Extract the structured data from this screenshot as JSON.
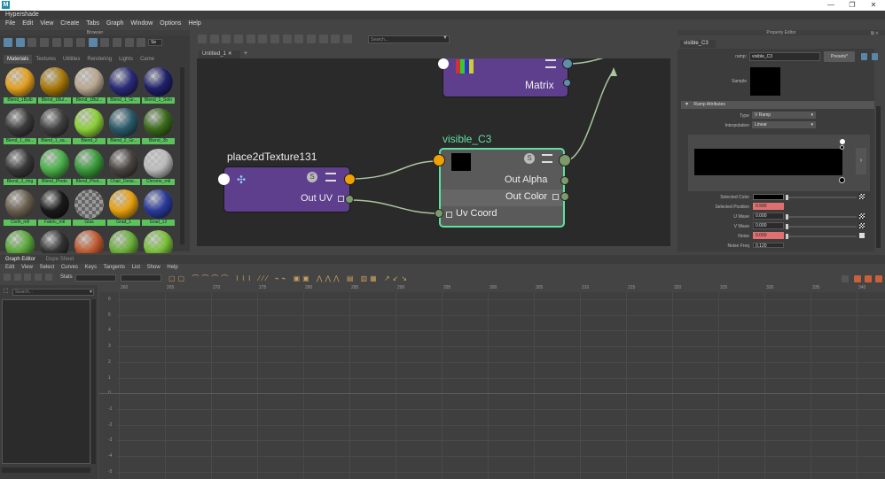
{
  "window": {
    "icon": "M",
    "minimize": "—",
    "maximize": "❐",
    "close": "✕",
    "title": "Hypershade"
  },
  "menubar": [
    "File",
    "Edit",
    "View",
    "Create",
    "Tabs",
    "Graph",
    "Window",
    "Options",
    "Help"
  ],
  "browser": {
    "title": "Browser",
    "search_placeholder": "Se",
    "tabs": [
      "Materials",
      "Textures",
      "Utilities",
      "Rendering",
      "Lights",
      "Came"
    ],
    "swatches": [
      {
        "label": "Blend_1Bulb",
        "color": "#e2a020"
      },
      {
        "label": "Blend_1Bul...",
        "color": "#a8780a"
      },
      {
        "label": "Blend_1Bul...",
        "color": "#b8a890"
      },
      {
        "label": "Blend_1_Gr...",
        "color": "#2a2a78"
      },
      {
        "label": "Blend_1_Solo",
        "color": "#20206a"
      },
      {
        "label": "Blend_1_cle...",
        "color": "#3a3a3a"
      },
      {
        "label": "Blend_1_sa...",
        "color": "#404040"
      },
      {
        "label": "Blend_2",
        "color": "#8ccf3a"
      },
      {
        "label": "Blend_2_Gr...",
        "color": "#2a5a6a"
      },
      {
        "label": "Blend_2b",
        "color": "#3a6a1a"
      },
      {
        "label": "Blend_3_ring",
        "color": "#383838"
      },
      {
        "label": "Blend_Photo",
        "color": "#4ab04a"
      },
      {
        "label": "Blend_Phot...",
        "color": "#3a9a3a"
      },
      {
        "label": "Chair_Detai...",
        "color": "#4a4440"
      },
      {
        "label": "Chrome_mtl",
        "color": "#bbbbbb"
      },
      {
        "label": "Cloth_mtl",
        "color": "#6a6050"
      },
      {
        "label": "Fabric_mtl",
        "color": "#1a1a1a"
      },
      {
        "label": "Glas",
        "color": "transparent"
      },
      {
        "label": "Grad_1",
        "color": "#e8a010"
      },
      {
        "label": "Grad_12",
        "color": "#2a3a9a"
      },
      {
        "label": "",
        "color": "#5aa83a"
      },
      {
        "label": "",
        "color": "#333333"
      },
      {
        "label": "",
        "color": "#c05a30"
      },
      {
        "label": "",
        "color": "#6ab03a"
      },
      {
        "label": "",
        "color": "#7ac03a"
      }
    ]
  },
  "hypershade": {
    "search_placeholder": "Search...",
    "tab": "Untitled_1",
    "tab_close": "✕",
    "add_tab": "+",
    "nodes": {
      "matrix": {
        "title": "Matrix"
      },
      "place2d": {
        "title": "place2dTexture131",
        "out_uv": "Out UV"
      },
      "visible": {
        "title": "visible_C3",
        "out_alpha": "Out Alpha",
        "out_color": "Out Color",
        "uv_coord": "Uv Coord"
      }
    }
  },
  "property_editor": {
    "title": "Property Editor",
    "tab": "visible_C3",
    "ramp_label": "ramp:",
    "ramp_name": "visible_C3",
    "presets": "Presets*",
    "sample_label": "Sample",
    "section": "Ramp Attributes",
    "type_label": "Type",
    "type_value": "V Ramp",
    "interp_label": "Interpolation",
    "interp_value": "Linear",
    "selected_color_label": "Selected Color",
    "selected_position_label": "Selected Position",
    "selected_position": "0.990",
    "u_wave_label": "U Wave",
    "u_wave": "0.000",
    "v_wave_label": "V Wave",
    "v_wave": "0.000",
    "noise_label": "Noise",
    "noise": "0.000",
    "noise_freq_label": "Noise Freq",
    "noise_freq": "0.120"
  },
  "graph_editor": {
    "tabs": [
      "Graph Editor",
      "Dope Sheet"
    ],
    "menu": [
      "Edit",
      "View",
      "Select",
      "Curves",
      "Keys",
      "Tangents",
      "List",
      "Show",
      "Help"
    ],
    "stats_label": "Stats",
    "search_placeholder": "Search...",
    "x_ticks": [
      "260",
      "265",
      "270",
      "275",
      "280",
      "285",
      "290",
      "295",
      "300",
      "305",
      "310",
      "315",
      "320",
      "325",
      "330",
      "335",
      "340"
    ],
    "y_ticks": [
      "6",
      "5",
      "4",
      "3",
      "2",
      "1",
      "0",
      "-1",
      "-2",
      "-3",
      "-4",
      "-5"
    ]
  }
}
